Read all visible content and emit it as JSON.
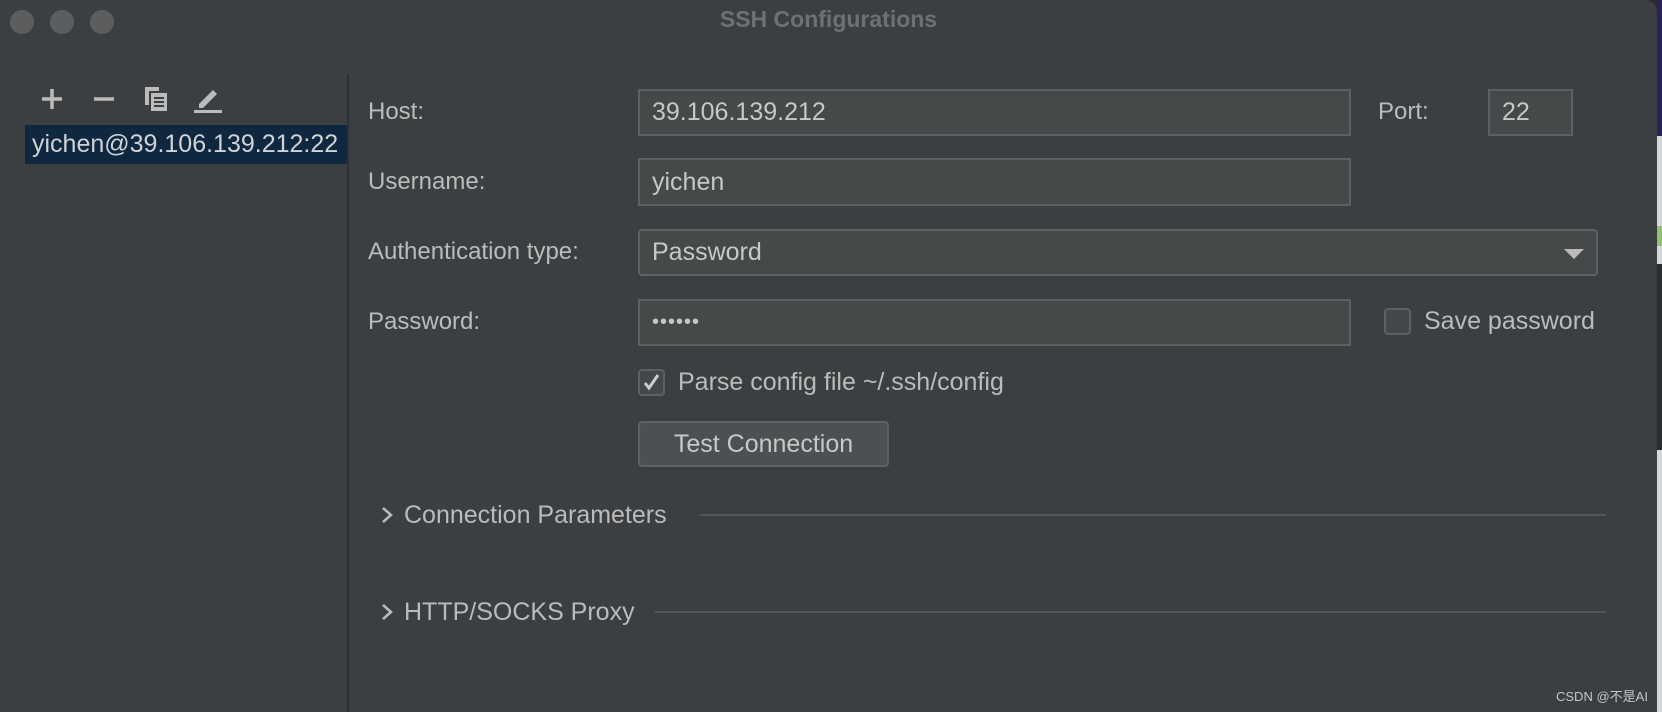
{
  "window": {
    "title": "SSH Configurations"
  },
  "toolbar": {
    "icons": [
      "plus-icon",
      "minus-icon",
      "copy-icon",
      "edit-icon"
    ]
  },
  "sidebar": {
    "items": [
      {
        "label": "yichen@39.106.139.212:22",
        "selected": true
      }
    ]
  },
  "form": {
    "host_label": "Host:",
    "host_value": "39.106.139.212",
    "port_label": "Port:",
    "port_value": "22",
    "username_label": "Username:",
    "username_value": "yichen",
    "auth_label": "Authentication type:",
    "auth_value": "Password",
    "password_label": "Password:",
    "password_value": "••••••",
    "save_password_label": "Save password",
    "save_password_checked": false,
    "parse_config_label": "Parse config file ~/.ssh/config",
    "parse_config_checked": true,
    "test_button": "Test Connection"
  },
  "sections": [
    {
      "label": "Connection Parameters",
      "expanded": false
    },
    {
      "label": "HTTP/SOCKS Proxy",
      "expanded": false
    }
  ],
  "watermark": "CSDN @不是AI",
  "colors": {
    "background": "#3c3f41",
    "selection": "#0f2840",
    "text": "#bbbbbb"
  }
}
